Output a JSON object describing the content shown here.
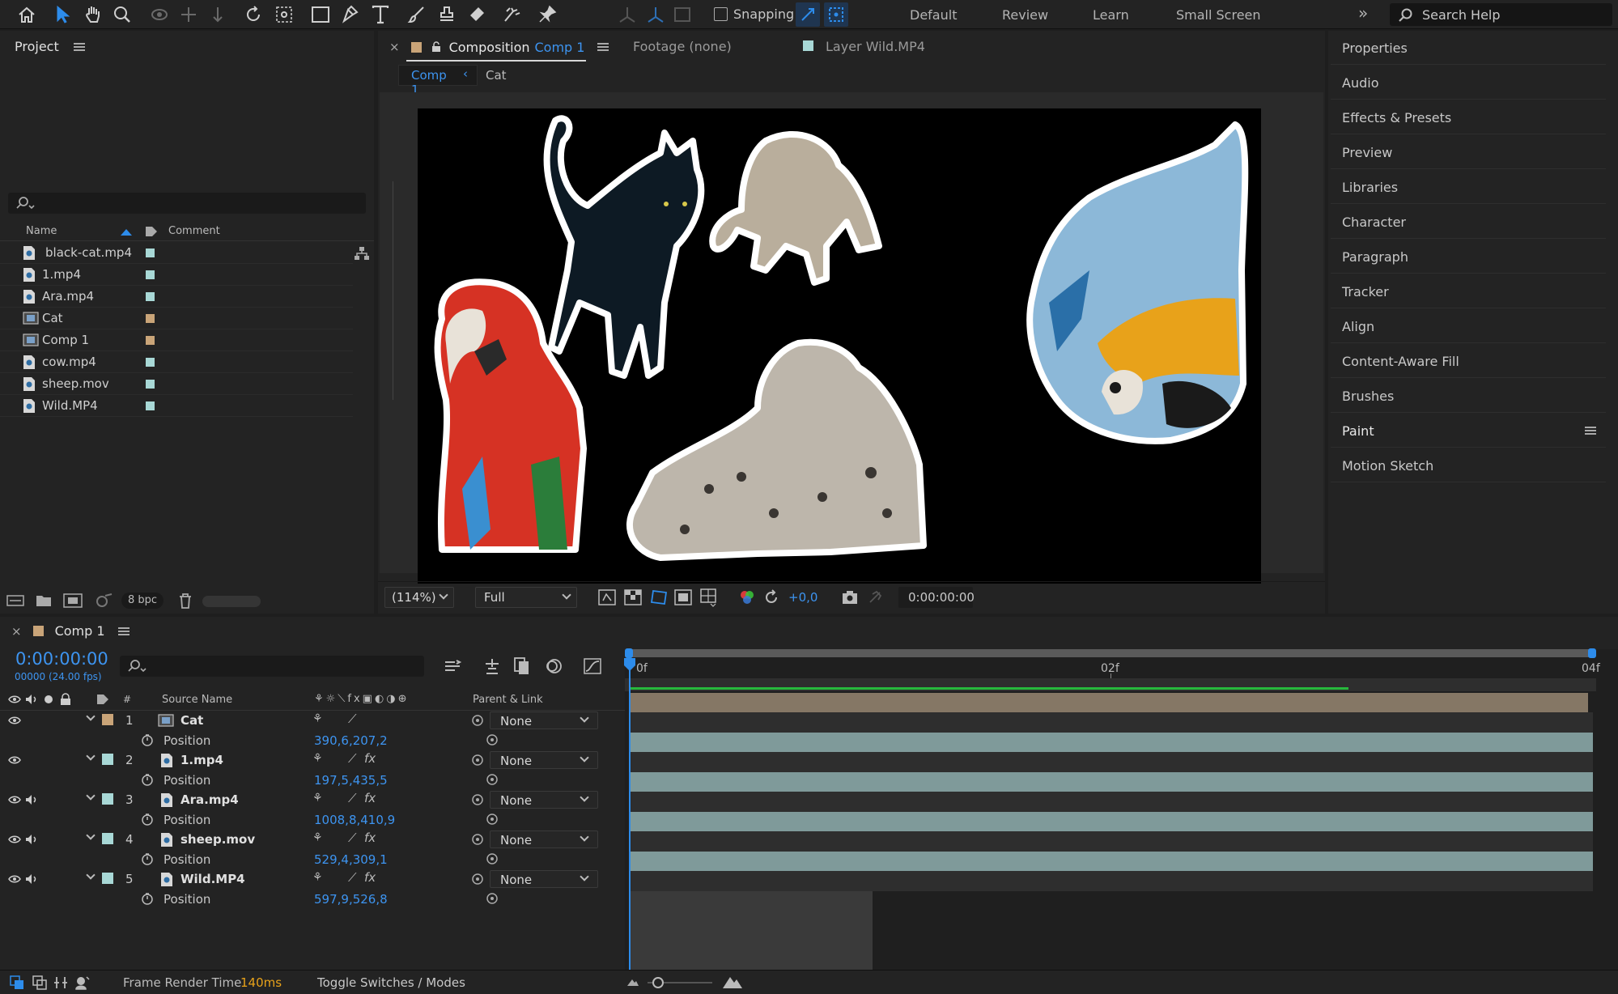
{
  "toolbar": {
    "snapping_label": "Snapping",
    "workspaces": [
      "Default",
      "Review",
      "Learn",
      "Small Screen"
    ],
    "search_placeholder": "Search Help"
  },
  "project": {
    "title": "Project",
    "col_name": "Name",
    "col_comment": "Comment",
    "items": [
      {
        "name": "black-cat.mp4",
        "kind": "footage",
        "color": "#a8d8d6"
      },
      {
        "name": "1.mp4",
        "kind": "footage",
        "color": "#a8d8d6"
      },
      {
        "name": "Ara.mp4",
        "kind": "footage",
        "color": "#a8d8d6"
      },
      {
        "name": "Cat",
        "kind": "comp",
        "color": "#c9a478"
      },
      {
        "name": "Comp 1",
        "kind": "comp",
        "color": "#c9a478"
      },
      {
        "name": "cow.mp4",
        "kind": "footage",
        "color": "#a8d8d6"
      },
      {
        "name": "sheep.mov",
        "kind": "footage",
        "color": "#a8d8d6"
      },
      {
        "name": "Wild.MP4",
        "kind": "footage",
        "color": "#a8d8d6"
      }
    ],
    "bpc": "8 bpc"
  },
  "composition": {
    "tab_prefix": "Composition",
    "tab_comp": "Comp 1",
    "footage_tab": "Footage (none)",
    "layer_tab": "Layer Wild.MP4",
    "breadcrumb": [
      "Comp 1",
      "Cat"
    ],
    "zoom": "(114%)",
    "resolution": "Full",
    "exposure": "+0,0",
    "timecode": "0:00:00:00"
  },
  "right_panel": {
    "items": [
      "Properties",
      "Audio",
      "Effects & Presets",
      "Preview",
      "Libraries",
      "Character",
      "Paragraph",
      "Tracker",
      "Align",
      "Content-Aware Fill",
      "Brushes",
      "Paint",
      "Motion Sketch"
    ]
  },
  "timeline": {
    "comp_name": "Comp 1",
    "timecode": "0:00:00:00",
    "frames": "00000 (24.00 fps)",
    "col_hash": "#",
    "col_source": "Source Name",
    "col_parent": "Parent & Link",
    "ruler": [
      "0f",
      "02f",
      "04f"
    ],
    "layers": [
      {
        "num": "1",
        "name": "Cat",
        "kind": "comp",
        "color": "#c9a478",
        "prop": "Position",
        "value": "390,6,207,2",
        "parent": "None",
        "audio": false
      },
      {
        "num": "2",
        "name": "1.mp4",
        "kind": "footage",
        "color": "#a8d8d6",
        "prop": "Position",
        "value": "197,5,435,5",
        "parent": "None",
        "audio": false
      },
      {
        "num": "3",
        "name": "Ara.mp4",
        "kind": "footage",
        "color": "#a8d8d6",
        "prop": "Position",
        "value": "1008,8,410,9",
        "parent": "None",
        "audio": true
      },
      {
        "num": "4",
        "name": "sheep.mov",
        "kind": "footage",
        "color": "#a8d8d6",
        "prop": "Position",
        "value": "529,4,309,1",
        "parent": "None",
        "audio": true
      },
      {
        "num": "5",
        "name": "Wild.MP4",
        "kind": "footage",
        "color": "#a8d8d6",
        "prop": "Position",
        "value": "597,9,526,8",
        "parent": "None",
        "audio": true
      }
    ]
  },
  "status": {
    "render_label": "Frame Render Time",
    "render_value": "140ms",
    "toggle_label": "Toggle Switches / Modes"
  }
}
